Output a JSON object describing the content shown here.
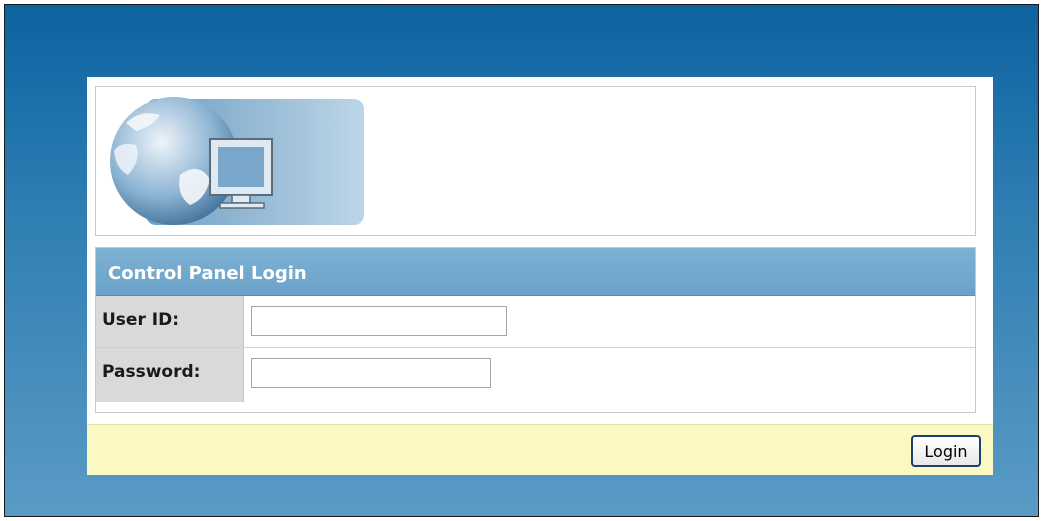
{
  "login": {
    "title": "Control Panel Login",
    "user_id_label": "User ID:",
    "password_label": "Password:",
    "user_id_value": "",
    "password_value": "",
    "submit_label": "Login"
  },
  "icons": {
    "logo": "globe-monitor-logo"
  },
  "colors": {
    "background_top": "#0d62a0",
    "background_bottom": "#5a9bc5",
    "header": "#6aa2c8",
    "footer": "#fbf8c4",
    "label_cell": "#d9d9d9"
  }
}
